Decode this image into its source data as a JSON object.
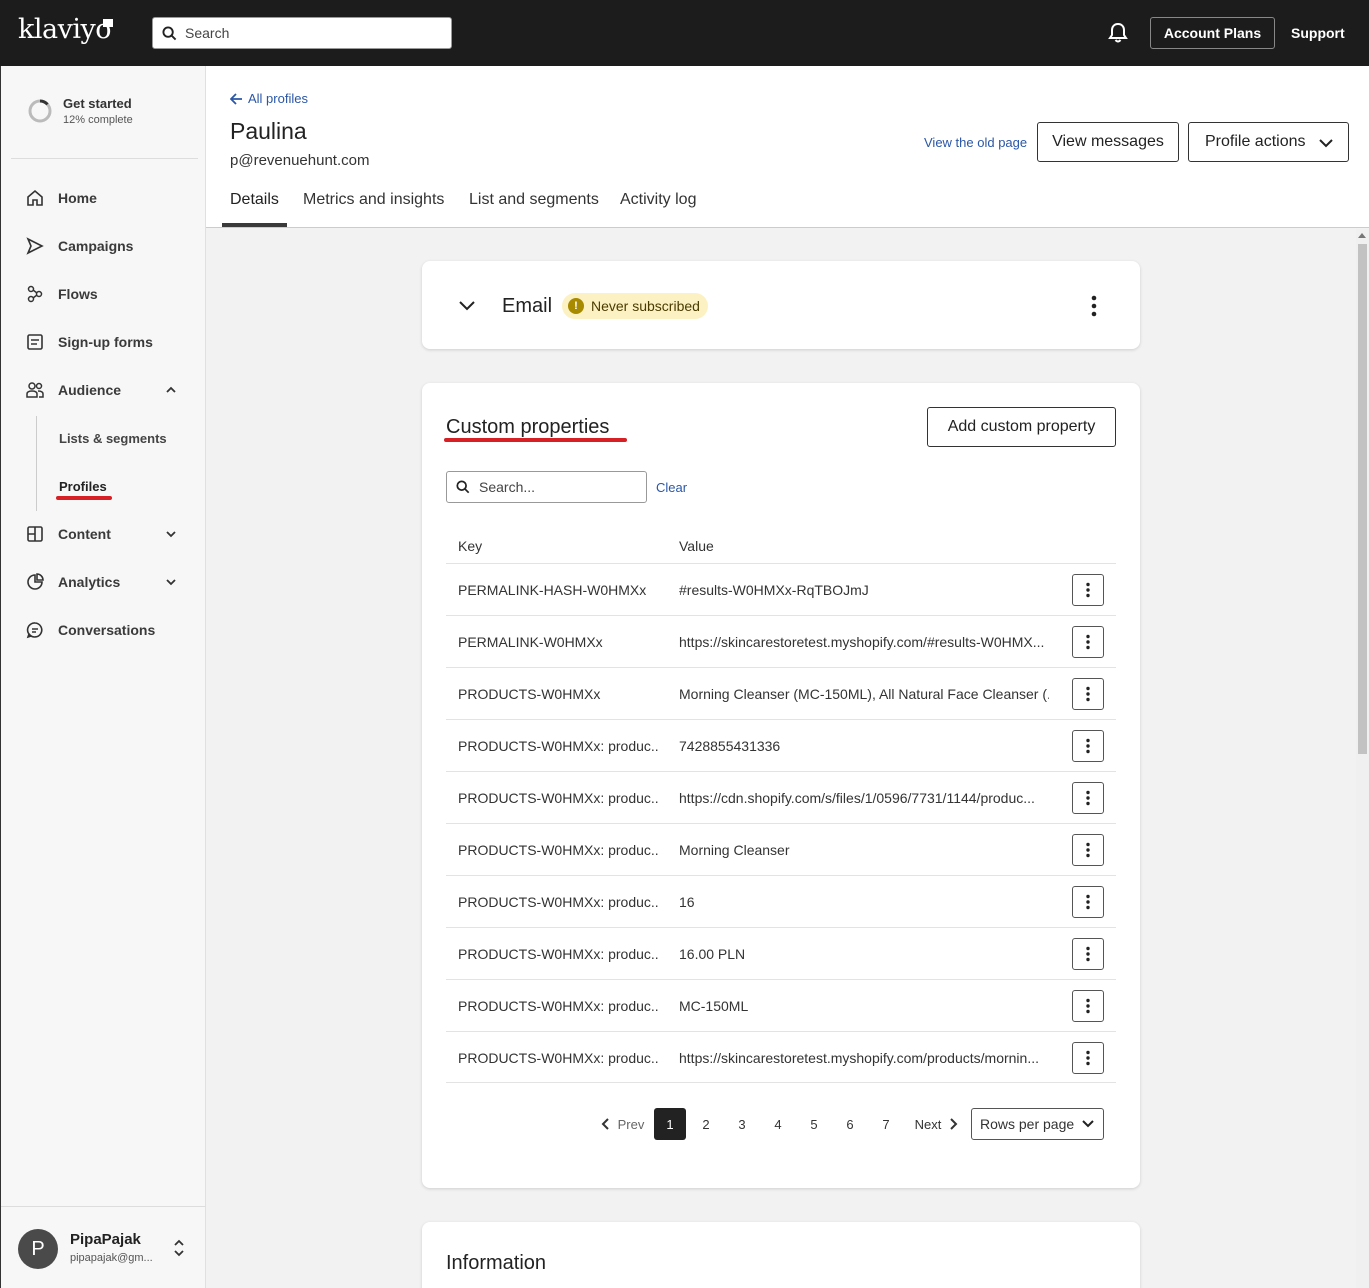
{
  "topbar": {
    "logo": "klaviyo",
    "search_placeholder": "Search",
    "account_plans": "Account Plans",
    "support": "Support"
  },
  "sidebar": {
    "get_started": {
      "title": "Get started",
      "progress": "12% complete",
      "progress_fraction": 0.12
    },
    "items": [
      {
        "label": "Home",
        "icon": "home-icon"
      },
      {
        "label": "Campaigns",
        "icon": "send-icon"
      },
      {
        "label": "Flows",
        "icon": "flows-icon"
      },
      {
        "label": "Sign-up forms",
        "icon": "form-icon"
      },
      {
        "label": "Audience",
        "icon": "audience-icon",
        "expanded": true
      },
      {
        "label": "Content",
        "icon": "content-icon"
      },
      {
        "label": "Analytics",
        "icon": "analytics-icon"
      },
      {
        "label": "Conversations",
        "icon": "chat-icon"
      }
    ],
    "audience_sub": [
      {
        "label": "Lists & segments"
      },
      {
        "label": "Profiles",
        "active": true
      }
    ],
    "user": {
      "initial": "P",
      "name": "PipaPajak",
      "email": "pipapajak@gm..."
    }
  },
  "header": {
    "back_link": "All profiles",
    "name": "Paulina",
    "email": "p@revenuehunt.com",
    "old_page": "View the old page",
    "view_messages": "View messages",
    "profile_actions": "Profile actions",
    "tabs": [
      "Details",
      "Metrics and insights",
      "List and segments",
      "Activity log"
    ],
    "active_tab": "Details"
  },
  "email_card": {
    "title": "Email",
    "badge": "Never subscribed",
    "badge_icon": "!"
  },
  "custom_properties": {
    "title": "Custom properties",
    "add_button": "Add custom property",
    "search_placeholder": "Search...",
    "clear": "Clear",
    "columns": {
      "key": "Key",
      "value": "Value"
    },
    "rows": [
      {
        "key": "PERMALINK-HASH-W0HMXx",
        "value": "#results-W0HMXx-RqTBOJmJ"
      },
      {
        "key": "PERMALINK-W0HMXx",
        "value": "https://skincarestoretest.myshopify.com/#results-W0HMX..."
      },
      {
        "key": "PRODUCTS-W0HMXx",
        "value": "Morning Cleanser (MC-150ML), All Natural Face Cleanser (..."
      },
      {
        "key": "PRODUCTS-W0HMXx: produc...",
        "value": "7428855431336"
      },
      {
        "key": "PRODUCTS-W0HMXx: produc...",
        "value": "https://cdn.shopify.com/s/files/1/0596/7731/1144/produc..."
      },
      {
        "key": "PRODUCTS-W0HMXx: produc...",
        "value": "Morning Cleanser"
      },
      {
        "key": "PRODUCTS-W0HMXx: produc...",
        "value": "16"
      },
      {
        "key": "PRODUCTS-W0HMXx: produc...",
        "value": "16.00 PLN"
      },
      {
        "key": "PRODUCTS-W0HMXx: produc...",
        "value": "MC-150ML"
      },
      {
        "key": "PRODUCTS-W0HMXx: produc...",
        "value": "https://skincarestoretest.myshopify.com/products/mornin..."
      }
    ],
    "pagination": {
      "prev": "Prev",
      "next": "Next",
      "pages": [
        "1",
        "2",
        "3",
        "4",
        "5",
        "6",
        "7"
      ],
      "current": "1",
      "rows_per_page": "Rows per page"
    }
  },
  "information": {
    "title": "Information"
  },
  "colors": {
    "topbar": "#1c1c1c",
    "link": "#2b57a6",
    "highlight": "#d62026",
    "badge_bg": "#fcf1c2"
  }
}
